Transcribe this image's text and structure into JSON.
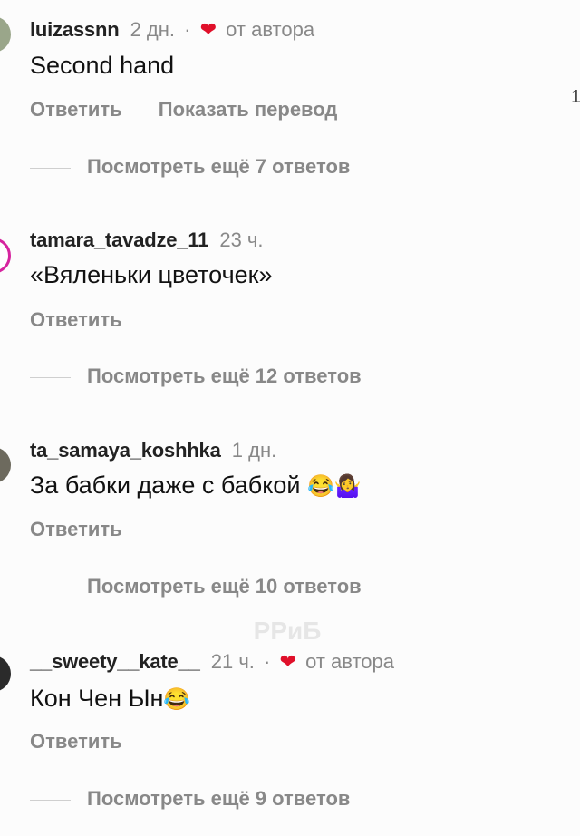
{
  "comments": [
    {
      "username": "luizassnn",
      "time": "2 дн.",
      "liked_by_author": true,
      "liked_label": "от автора",
      "text": "Second hand",
      "actions": [
        "Ответить",
        "Показать перевод"
      ],
      "replies_label": "Посмотреть ещё 7 ответов"
    },
    {
      "username": "tamara_tavadze_11",
      "time": "23 ч.",
      "liked_by_author": false,
      "text": "«Вяленьки цветочек»",
      "actions": [
        "Ответить"
      ],
      "replies_label": "Посмотреть ещё 12 ответов"
    },
    {
      "username": "ta_samaya_koshhka",
      "time": "1 дн.",
      "liked_by_author": false,
      "text": "За бабки даже с бабкой",
      "emoji": "😂🤷‍♀️",
      "actions": [
        "Ответить"
      ],
      "replies_label": "Посмотреть ещё 10 ответов"
    },
    {
      "username": "__sweety__kate__",
      "time": "21 ч.",
      "liked_by_author": true,
      "liked_label": "от автора",
      "text": "Кон Чен Ын",
      "emoji": "😂",
      "actions": [
        "Ответить"
      ],
      "replies_label": "Посмотреть ещё 9 ответов"
    }
  ],
  "watermark": "PPиБ",
  "edge_number": "1",
  "colors": {
    "heart": "#e0102a",
    "muted": "#888888",
    "ring": "#d6249f"
  }
}
